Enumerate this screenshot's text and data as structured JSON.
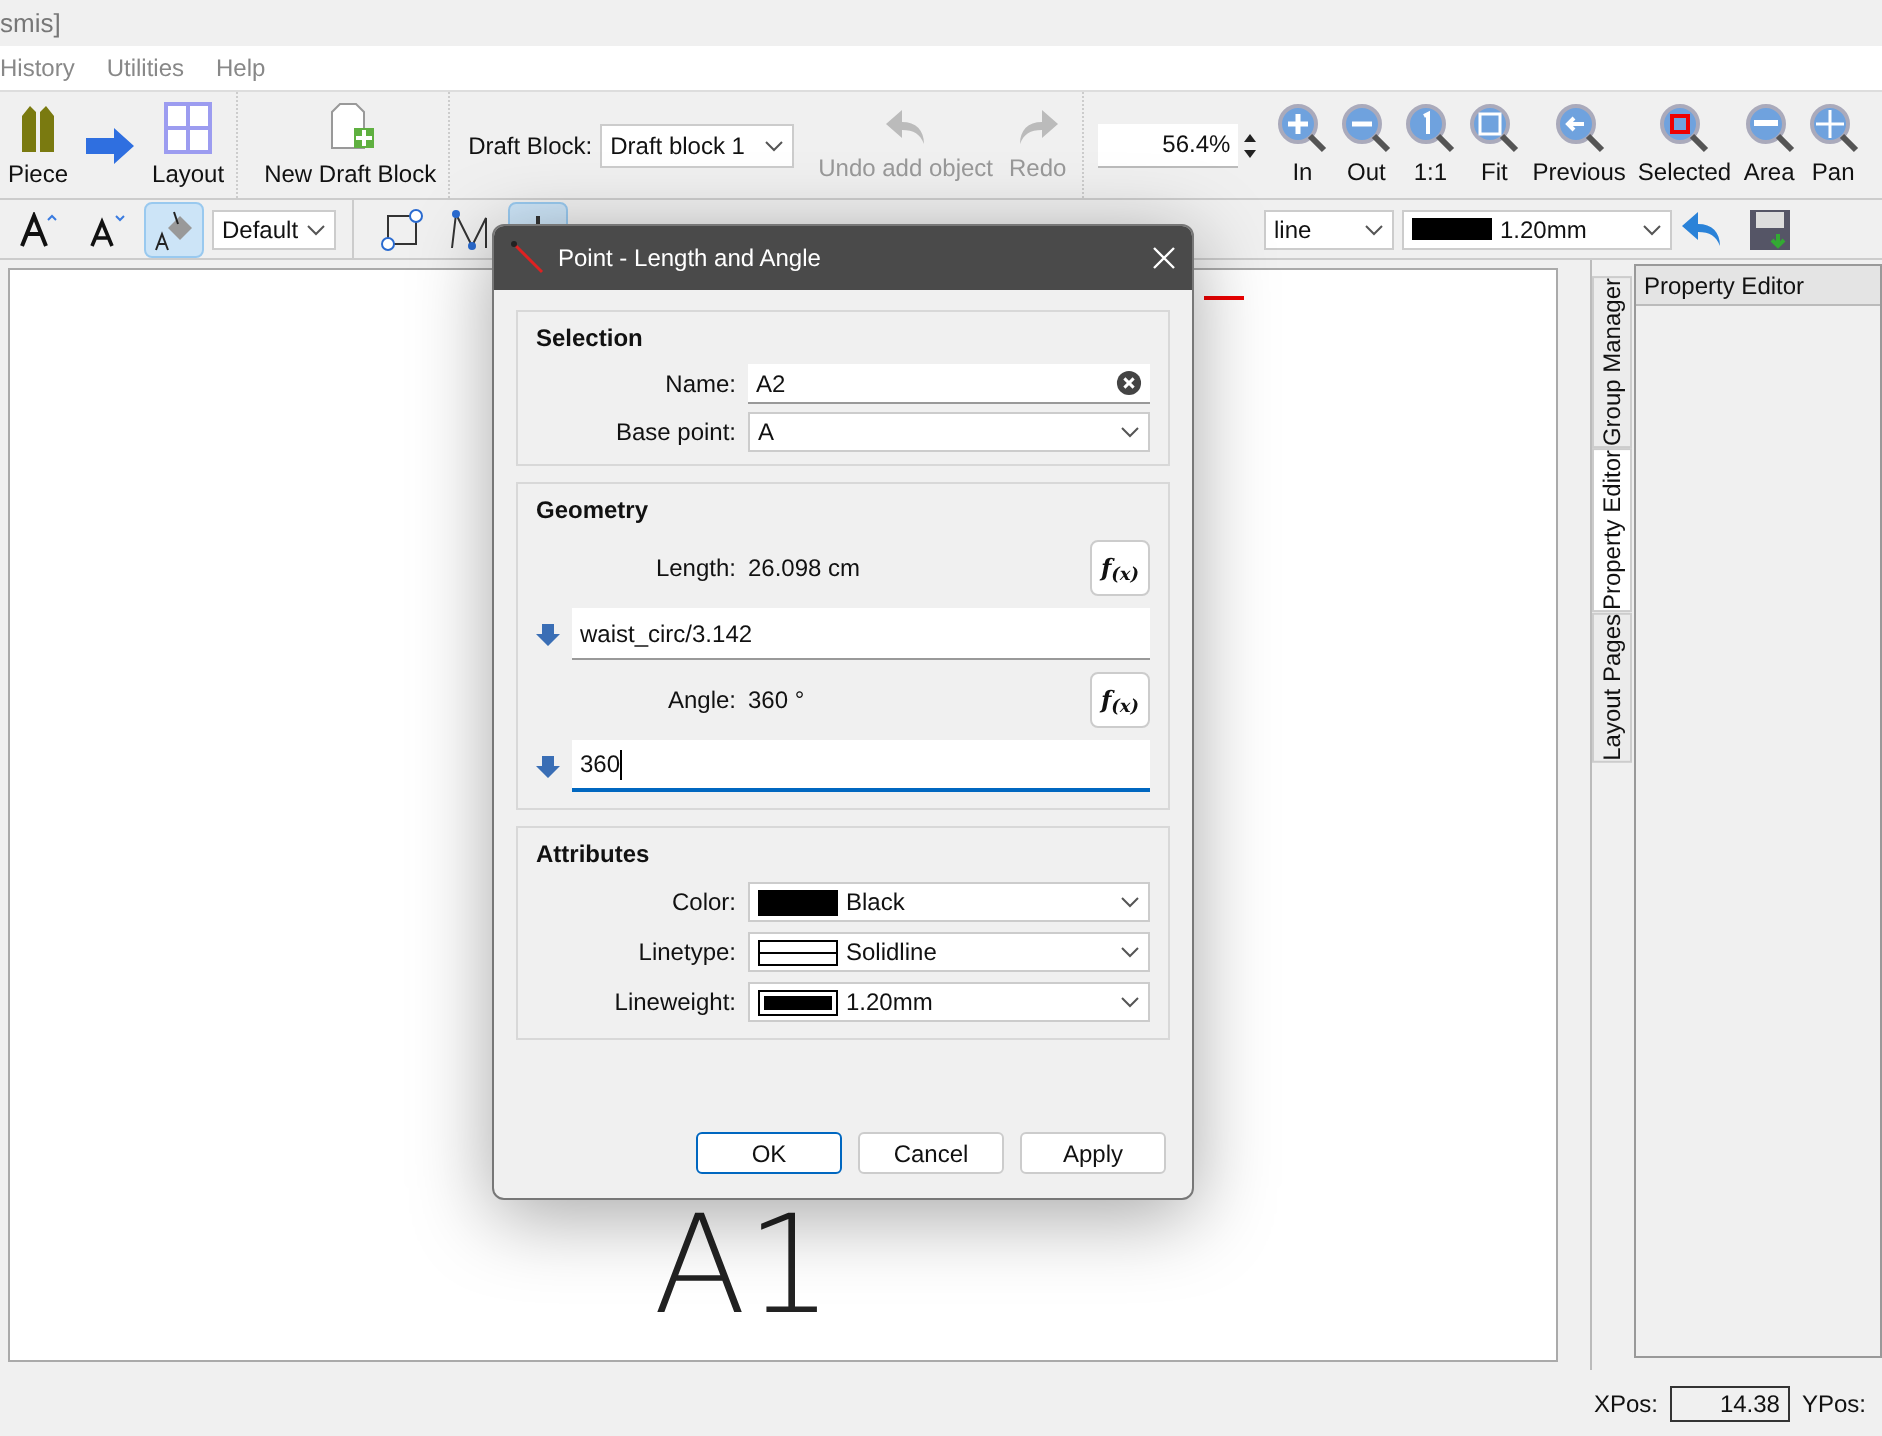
{
  "window": {
    "title": "smis]"
  },
  "menu": [
    {
      "label": "History"
    },
    {
      "label": "Utilities"
    },
    {
      "label": "Help"
    }
  ],
  "toolbar": [
    {
      "label": "Piece",
      "disabled": false
    },
    {
      "label": "Layout",
      "disabled": false
    },
    {
      "label": "New Draft Block",
      "disabled": false
    },
    {
      "label": "Undo add object",
      "disabled": true
    },
    {
      "label": "Redo",
      "disabled": true
    }
  ],
  "draft_block": {
    "label": "Draft Block:",
    "value": "Draft block 1"
  },
  "zoom": {
    "value": "56.4%",
    "buttons": [
      {
        "label": "In"
      },
      {
        "label": "Out"
      },
      {
        "label": "1:1"
      },
      {
        "label": "Fit"
      },
      {
        "label": "Previous"
      },
      {
        "label": "Selected"
      },
      {
        "label": "Area"
      },
      {
        "label": "Pan"
      }
    ]
  },
  "toolbar2": {
    "tools": [
      {
        "selected": false
      },
      {
        "selected": false
      },
      {
        "selected": true
      }
    ],
    "font": "Default",
    "drawing_tools": [
      {
        "selected": false
      },
      {
        "selected": false
      },
      {
        "selected": true
      }
    ],
    "linetype": "line",
    "lineweight": "1.20mm"
  },
  "canvas": {
    "label": "A1"
  },
  "dock": {
    "tabs": [
      {
        "label": "Group Manager",
        "selected": false
      },
      {
        "label": "Property Editor",
        "selected": true
      },
      {
        "label": "Layout Pages",
        "selected": false
      }
    ],
    "panel_title": "Property Editor"
  },
  "status_bar": {
    "xpos_label": "XPos:",
    "xpos": "14.38",
    "ypos_label": "YPos:"
  },
  "dialog": {
    "title": "Point - Length and Angle",
    "selection": {
      "title": "Selection",
      "name": {
        "label": "Name:",
        "value": "A2"
      },
      "base_point": {
        "label": "Base point:",
        "value": "A"
      }
    },
    "geometry": {
      "title": "Geometry",
      "fields": [
        {
          "label": "Length:",
          "reading": "26.098 cm",
          "function_button": "f$_{(x)}$",
          "formula": "waist_circ/3.142",
          "focused": false
        },
        {
          "label": "Angle:",
          "reading": "360 °",
          "function_button": "f$_{(x)}$",
          "formula": "360",
          "focused": true
        }
      ]
    },
    "attributes": {
      "title": "Attributes",
      "fields": [
        {
          "kind": "color",
          "label": "Color:",
          "value": "Black"
        },
        {
          "kind": "linetype",
          "label": "Linetype:",
          "value": "Solidline"
        },
        {
          "kind": "lineweight",
          "label": "Lineweight:",
          "value": "1.20mm"
        }
      ]
    },
    "buttons": [
      {
        "label": "OK",
        "default": true
      },
      {
        "label": "Cancel",
        "default": false
      },
      {
        "label": "Apply",
        "default": false
      }
    ]
  }
}
